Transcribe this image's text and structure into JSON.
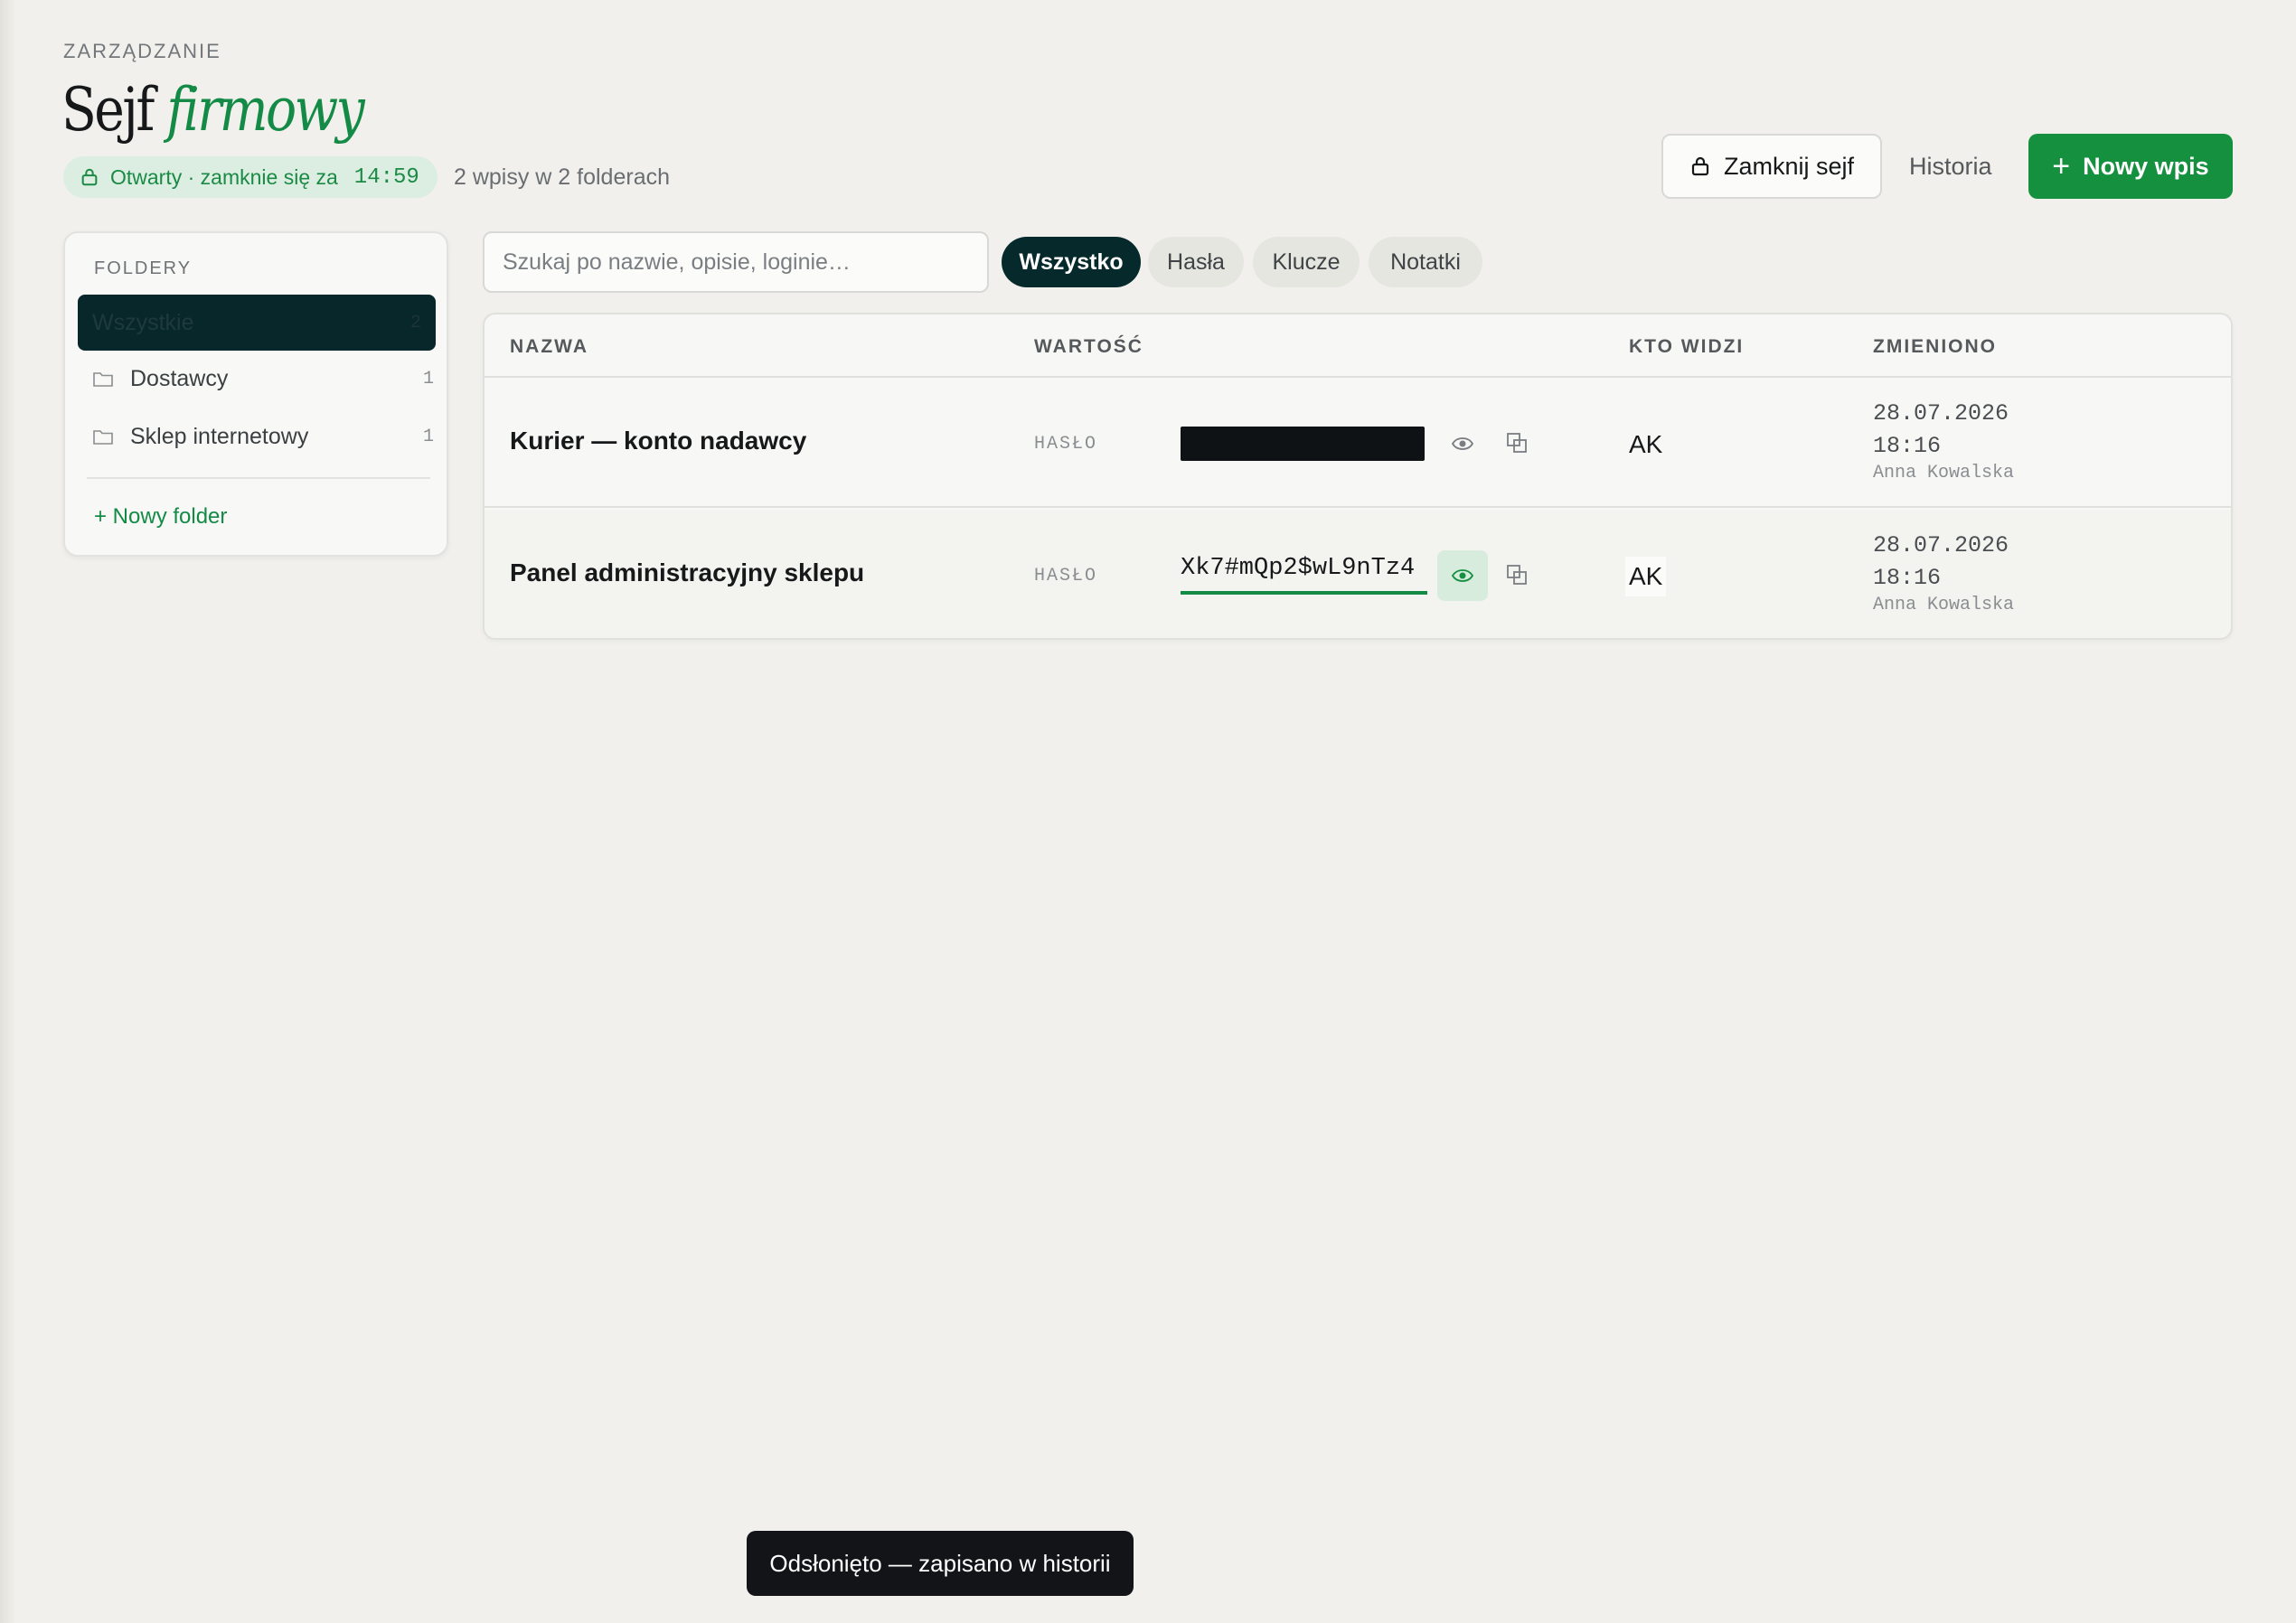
{
  "header": {
    "eyebrow": "ZARZĄDZANIE",
    "title_main": "Sejf",
    "title_accent": "firmowy",
    "status_text": "Otwarty · zamknie się za",
    "status_timer": "14:59",
    "count_text": "2 wpisy w 2 folderach"
  },
  "actions": {
    "lock_label": "Zamknij sejf",
    "history_label": "Historia",
    "new_label": "Nowy wpis",
    "new_icon": "plus-icon"
  },
  "sidebar": {
    "heading": "FOLDERY",
    "items": [
      {
        "label": "Wszystkie",
        "count": "2",
        "active": true
      },
      {
        "label": "Dostawcy",
        "count": "1",
        "icon": "folder-icon"
      },
      {
        "label": "Sklep internetowy",
        "count": "1",
        "icon": "folder-icon"
      }
    ],
    "new_folder": "+ Nowy folder"
  },
  "search": {
    "placeholder": "Szukaj po nazwie, opisie, loginie…"
  },
  "filters": [
    {
      "label": "Wszystko",
      "active": true
    },
    {
      "label": "Hasła"
    },
    {
      "label": "Klucze"
    },
    {
      "label": "Notatki"
    }
  ],
  "table": {
    "columns": [
      "NAZWA",
      "WARTOŚĆ",
      "KTO WIDZI",
      "ZMIENIONO"
    ],
    "rows": [
      {
        "name": "Kurier — konto nadawcy",
        "type": "HASŁO",
        "value": "",
        "revealed": false,
        "who": "AK",
        "date": "28.07.2026",
        "time": "18:16",
        "user": "Anna Kowalska"
      },
      {
        "name": "Panel administracyjny sklepu",
        "type": "HASŁO",
        "value": "Xk7#mQp2$wL9nTz4",
        "revealed": true,
        "who": "AK",
        "date": "28.07.2026",
        "time": "18:16",
        "user": "Anna Kowalska"
      }
    ]
  },
  "toast": {
    "text": "Odsłonięto — zapisano w historii"
  },
  "colors": {
    "accent": "#15903f",
    "dark": "#062a2c",
    "background": "#f1f0ec"
  }
}
